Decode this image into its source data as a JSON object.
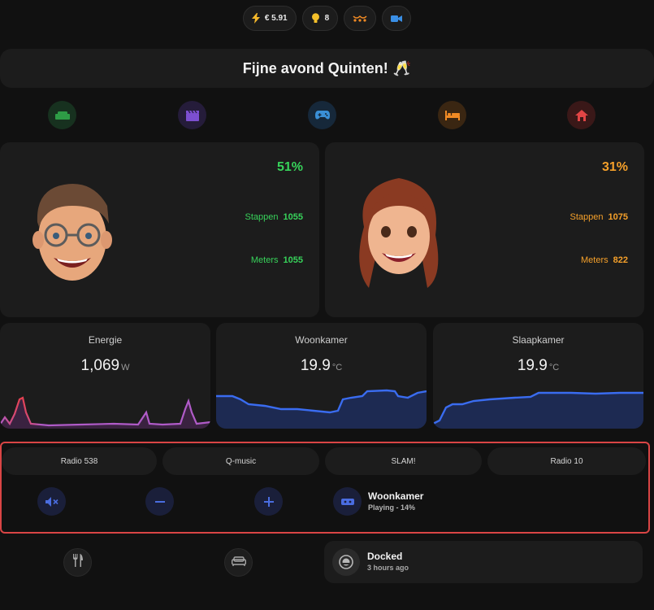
{
  "chips": {
    "energy_cost": "€ 5.91",
    "lights_on": "8"
  },
  "greeting": {
    "text": "Fijne avond Quinten!",
    "emoji": "🥂"
  },
  "rooms": [
    {
      "name": "living",
      "color": "#2e9b46",
      "bg": "#17311f"
    },
    {
      "name": "cinema",
      "color": "#7c4fd0",
      "bg": "#251c3a"
    },
    {
      "name": "gaming",
      "color": "#3a8fd6",
      "bg": "#16283a"
    },
    {
      "name": "bedroom",
      "color": "#f08a24",
      "bg": "#3a2612"
    },
    {
      "name": "home",
      "color": "#e04545",
      "bg": "#3a1818"
    }
  ],
  "persons": [
    {
      "percent": "51%",
      "steps_label": "Stappen",
      "steps": "1055",
      "meters_label": "Meters",
      "meters": "1055",
      "color": "#37d25a"
    },
    {
      "percent": "31%",
      "steps_label": "Stappen",
      "steps": "1075",
      "meters_label": "Meters",
      "meters": "822",
      "color": "#f5a02a"
    }
  ],
  "sensors": [
    {
      "title": "Energie",
      "value": "1,069",
      "unit": "W"
    },
    {
      "title": "Woonkamer",
      "value": "19.9",
      "unit": "°C"
    },
    {
      "title": "Slaapkamer",
      "value": "19.9",
      "unit": "°C"
    }
  ],
  "media": {
    "stations": [
      "Radio 538",
      "Q-music",
      "SLAM!",
      "Radio 10"
    ],
    "player_name": "Woonkamer",
    "player_status": "Playing - 14%",
    "volume_percent": 14
  },
  "vacuum": {
    "title": "Docked",
    "subtitle": "3 hours ago"
  },
  "colors": {
    "accent_blue": "#4a6de0",
    "graph_line_blue": "#3a6cf0",
    "energy_line": "#b05bc8",
    "energy_peak": "#e8404a",
    "highlight_border": "#d94545"
  }
}
